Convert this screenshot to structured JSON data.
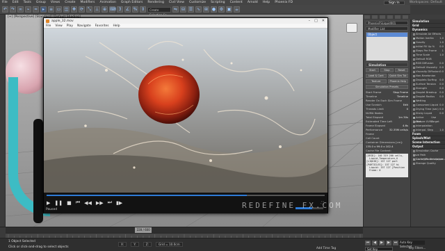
{
  "menubar": {
    "items": [
      "File",
      "Edit",
      "Tools",
      "Group",
      "Views",
      "Create",
      "Modifiers",
      "Animation",
      "Graph Editors",
      "Rendering",
      "Civil View",
      "Customize",
      "Scripting",
      "Content",
      "Arnold",
      "Help",
      "Phoenix FD"
    ],
    "sign_in": "Sign In",
    "workspaces": "Workspaces: Default"
  },
  "toolbar": {
    "selection_set": "Create Selection Se"
  },
  "viewport": {
    "label": "[+] [Perspective] [Standard] [Default Shading]"
  },
  "player": {
    "title": "apple_32.mov",
    "menu": [
      "File",
      "View",
      "Play",
      "Navigate",
      "Favorites",
      "Help"
    ],
    "status": "Paused",
    "progress": 0.72,
    "volume": 0.6
  },
  "watermark": "REDEFINE FX.COM",
  "command_panel": {
    "object_name": "PhoenixFSLiquid001",
    "modifier_list": "Modifier List",
    "stack_item": "Object",
    "sections": {
      "simulation": "Simulation"
    },
    "buttons_row1": [
      "Start",
      "Stop",
      "Reset"
    ],
    "buttons_row2": [
      "Load & Cont",
      "Quick Sim Tut"
    ],
    "buttons_row3": [
      "Texture",
      "Phoenix Help"
    ],
    "presets": "Simulation Presets",
    "lines": [
      {
        "label": "Start Frame",
        "value": "Stop Frame"
      },
      {
        "label": "Timeline",
        "value": "Timeline"
      },
      {
        "label": "Render On Each Sim Frame",
        "value": ""
      },
      {
        "label": "Use Scratch",
        "value": "Edit"
      },
      {
        "label": "Threads Limit",
        "value": "0"
      },
      {
        "label": "NUMA Nodes",
        "value": ""
      }
    ],
    "stats": [
      {
        "label": "Total Elapsed",
        "value": "1m 30s"
      },
      {
        "label": "Estimated Time Left",
        "value": ""
      },
      {
        "label": "Frame Elapsed",
        "value": "4.6s"
      },
      {
        "label": "Performance",
        "value": "32.35M cells/s"
      },
      {
        "label": "Frame",
        "value": ""
      },
      {
        "label": "Cell Count",
        "value": ""
      }
    ],
    "container": "Container Dimensions [cm]:",
    "container_value": "135.0 x 99.0 x 102.4",
    "cache_label": "Cache File Content:",
    "cache_text": "[GRID]: 140 319 200 cells,\n  Liquid,Temperature,U\n[LIQUID]: 157 127 part\n[PARTICLES]: 157 127 hi\n  Liquid: 157 127 [Position\n  Frame: 0"
  },
  "right_panel": {
    "sections": [
      {
        "title": "Simulation",
        "lines": []
      },
      {
        "title": "Grid",
        "lines": []
      },
      {
        "title": "Dynamics",
        "lines": [
          {
            "label": "Simulate Air Effects",
            "value": "",
            "checked": false
          },
          {
            "label": "Motion Inertia",
            "value": "1.0",
            "checked": true
          },
          {
            "label": "Gravity",
            "value": "1.0",
            "checked": true
          },
          {
            "label": "Initial Fill Up %",
            "value": "0.0",
            "checked": false
          },
          {
            "label": "Steps Per Frame",
            "value": "1",
            "checked": false
          },
          {
            "label": "Time Scale",
            "value": "1.0",
            "checked": false
          },
          {
            "label": "Default RGB",
            "value": "",
            "checked": false
          },
          {
            "label": "RGB Diffusion",
            "value": "0.0",
            "checked": false
          },
          {
            "label": "Default Viscosity",
            "value": "0.0",
            "checked": false
          },
          {
            "label": "Viscosity Diffusion",
            "value": "0.0",
            "checked": false
          },
          {
            "label": "Non-Newtonian",
            "value": "",
            "checked": false
          },
          {
            "label": "Droplets Surfing",
            "value": "0.0",
            "checked": false
          },
          {
            "label": "Surface Tension",
            "value": "0.0",
            "checked": false
          },
          {
            "label": "Strength",
            "value": "0.0",
            "checked": false
          },
          {
            "label": "Droplet Breakup",
            "value": "0.0",
            "checked": false
          },
          {
            "label": "Droplet Radius",
            "value": "0.0",
            "checked": false
          },
          {
            "label": "Wetting",
            "value": "",
            "checked": true
          },
          {
            "label": "Consumed Liquid",
            "value": "0.0",
            "checked": false
          },
          {
            "label": "Drying Time (sec)",
            "value": "0.0",
            "checked": false
          },
          {
            "label": "Sticky Liquid",
            "value": "0.0",
            "checked": false
          },
          {
            "label": "Active Bodies",
            "value": "Use Target",
            "checked": true
          },
          {
            "label": "Texture UVW",
            "value": "",
            "checked": false
          },
          {
            "label": "Interpolation",
            "value": "",
            "checked": false
          },
          {
            "label": "Interpol. Step",
            "value": "1.0",
            "checked": false
          }
        ]
      },
      {
        "title": "Foam",
        "lines": []
      },
      {
        "title": "Splash/Mist",
        "lines": []
      },
      {
        "title": "Scene Interaction",
        "lines": []
      },
      {
        "title": "Output",
        "lines": [
          {
            "label": "Simulation Cache Save Path",
            "value": "",
            "checked": false
          },
          {
            "label": "$(Cache)\\Phoenix\\apple.aur",
            "value": "",
            "checked": false
          },
          {
            "label": "Cacheless Simulation",
            "value": "",
            "checked": false
          },
          {
            "label": "Storage Quality",
            "value": "",
            "checked": false
          }
        ]
      }
    ]
  },
  "timeline": {
    "frame_label": "228 / 600",
    "current_frame": 228,
    "total_frames": 600
  },
  "status": {
    "line1": "1 Object Selected",
    "line2": "Click or click-and-drag to select objects",
    "x": "X:",
    "y": "Y:",
    "z": "Z:",
    "grid": "Grid = 10.0cm",
    "add_time_tag": "Add Time Tag",
    "auto_key": "Auto Key Selected",
    "set_key": "Set Key",
    "key_filters": "Key Filters..."
  }
}
